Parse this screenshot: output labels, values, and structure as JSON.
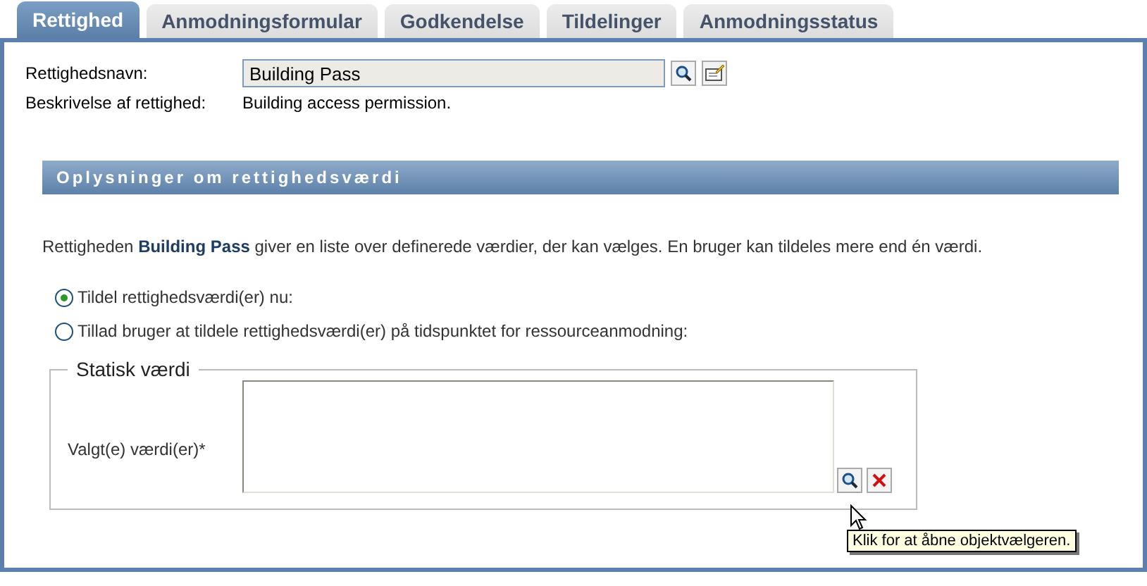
{
  "tabs": [
    {
      "label": "Rettighed",
      "selected": true
    },
    {
      "label": "Anmodningsformular",
      "selected": false
    },
    {
      "label": "Godkendelse",
      "selected": false
    },
    {
      "label": "Tildelinger",
      "selected": false
    },
    {
      "label": "Anmodningsstatus",
      "selected": false
    }
  ],
  "entitlement": {
    "name_label": "Rettighedsnavn:",
    "name_value": "Building Pass",
    "description_label": "Beskrivelse af rettighed:",
    "description_value": "Building access permission."
  },
  "section": {
    "title": "Oplysninger om rettighedsværdi",
    "intro": "Rettigheden **Building Pass** giver en liste over definerede værdier, der kan vælges. En bruger kan tildeles mere end én værdi."
  },
  "options": [
    {
      "label": "Tildel rettighedsværdi(er) nu:",
      "selected": true
    },
    {
      "label": "Tillad bruger at tildele rettighedsværdi(er) på tidspunktet for ressourceanmodning:",
      "selected": false
    }
  ],
  "static_value": {
    "legend": "Statisk værdi",
    "field_label": "Valgt(e) værdi(er)*",
    "tooltip": "Klik for at åbne objektvælgeren."
  }
}
